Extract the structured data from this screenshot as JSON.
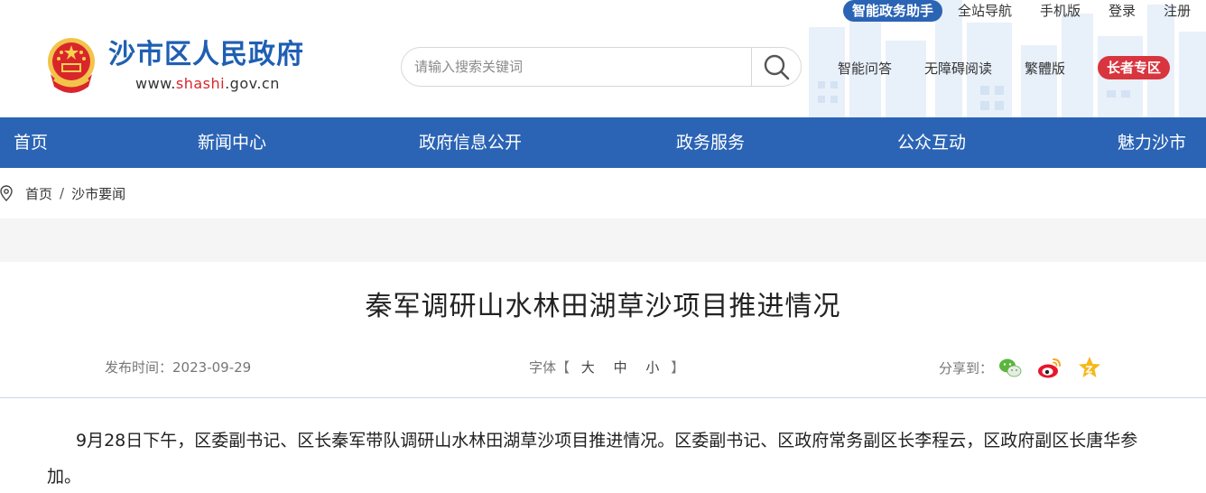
{
  "header": {
    "site_name": "沙市区人民政府",
    "site_url_prefix": "www.",
    "site_url_highlight": "shashi",
    "site_url_suffix": ".gov.cn",
    "brand_color": "#1f5fb3",
    "accent_red": "#d6262a"
  },
  "search": {
    "placeholder": "请输入搜索关键词",
    "value": "",
    "icon": "search-icon"
  },
  "top_links": {
    "assistant": "智能政务助手",
    "items": [
      "全站导航",
      "手机版",
      "登录",
      "注册"
    ]
  },
  "mid_links": {
    "items": [
      "智能问答",
      "无障碍阅读",
      "繁體版"
    ],
    "elder": "长者专区"
  },
  "nav": {
    "color": "#2b64b5",
    "items": [
      "首页",
      "新闻中心",
      "政府信息公开",
      "政务服务",
      "公众互动",
      "魅力沙市"
    ]
  },
  "breadcrumb": {
    "icon": "location-pin-icon",
    "items": [
      "首页",
      "沙市要闻"
    ],
    "separator": "/"
  },
  "article": {
    "title": "秦军调研山水林田湖草沙项目推进情况",
    "publish_label": "发布时间：",
    "publish_date": "2023-09-29",
    "font_label": "字体【",
    "font_large": "大",
    "font_medium": "中",
    "font_small": "小",
    "font_close": "】",
    "share_label": "分享到：",
    "share_icons": [
      "wechat-icon",
      "weibo-icon",
      "favorite-star-icon"
    ],
    "body": "9月28日下午，区委副书记、区长秦军带队调研山水林田湖草沙项目推进情况。区委副书记、区政府常务副区长李程云，区政府副区长唐华参加。"
  }
}
